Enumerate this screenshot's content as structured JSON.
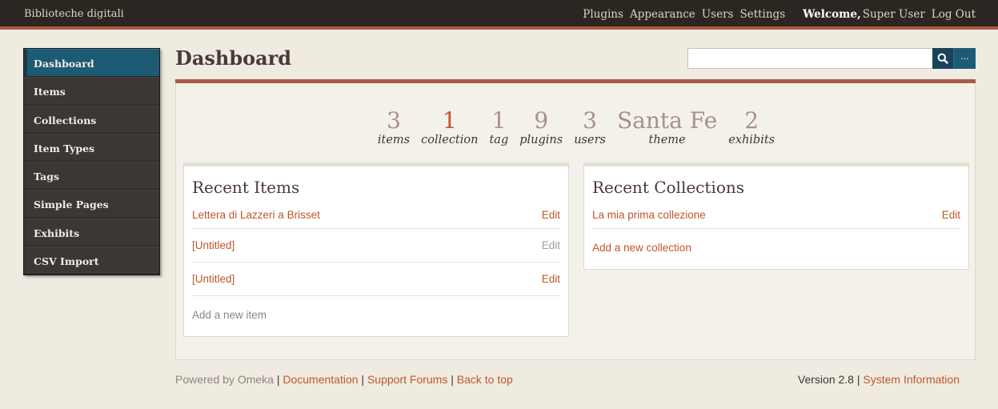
{
  "topbar": {
    "site_title": "Biblioteche digitali",
    "nav": [
      "Plugins",
      "Appearance",
      "Users",
      "Settings"
    ],
    "welcome": "Welcome,",
    "user": "Super User",
    "logout": "Log Out"
  },
  "sidebar": {
    "items": [
      {
        "label": "Dashboard"
      },
      {
        "label": "Items"
      },
      {
        "label": "Collections"
      },
      {
        "label": "Item Types"
      },
      {
        "label": "Tags"
      },
      {
        "label": "Simple Pages"
      },
      {
        "label": "Exhibits"
      },
      {
        "label": "CSV Import"
      }
    ]
  },
  "header": {
    "title": "Dashboard",
    "search_placeholder": "",
    "advanced_label": "..."
  },
  "stats": [
    {
      "num": "3",
      "label": "items"
    },
    {
      "num": "1",
      "label": "collection"
    },
    {
      "num": "1",
      "label": "tag"
    },
    {
      "num": "9",
      "label": "plugins"
    },
    {
      "num": "3",
      "label": "users"
    },
    {
      "num": "Santa Fe",
      "label": "theme"
    },
    {
      "num": "2",
      "label": "exhibits"
    }
  ],
  "recent_items": {
    "title": "Recent Items",
    "rows": [
      {
        "name": "Lettera di Lazzeri a Brisset",
        "action": "Edit"
      },
      {
        "name": "[Untitled]",
        "action": "Edit"
      },
      {
        "name": "[Untitled]",
        "action": "Edit"
      }
    ],
    "add_label": "Add a new item"
  },
  "recent_collections": {
    "title": "Recent Collections",
    "rows": [
      {
        "name": "La mia prima collezione",
        "action": "Edit"
      }
    ],
    "add_label": "Add a new collection"
  },
  "footer": {
    "powered": "Powered by Omeka",
    "documentation": "Documentation",
    "support": "Support Forums",
    "back_to_top": "Back to top",
    "version": "Version 2.8",
    "system_info": "System Information",
    "separator": " | "
  },
  "colors": {
    "accent": "#c0562b",
    "topbar": "#2b2621",
    "active_nav": "#1d5a74"
  }
}
